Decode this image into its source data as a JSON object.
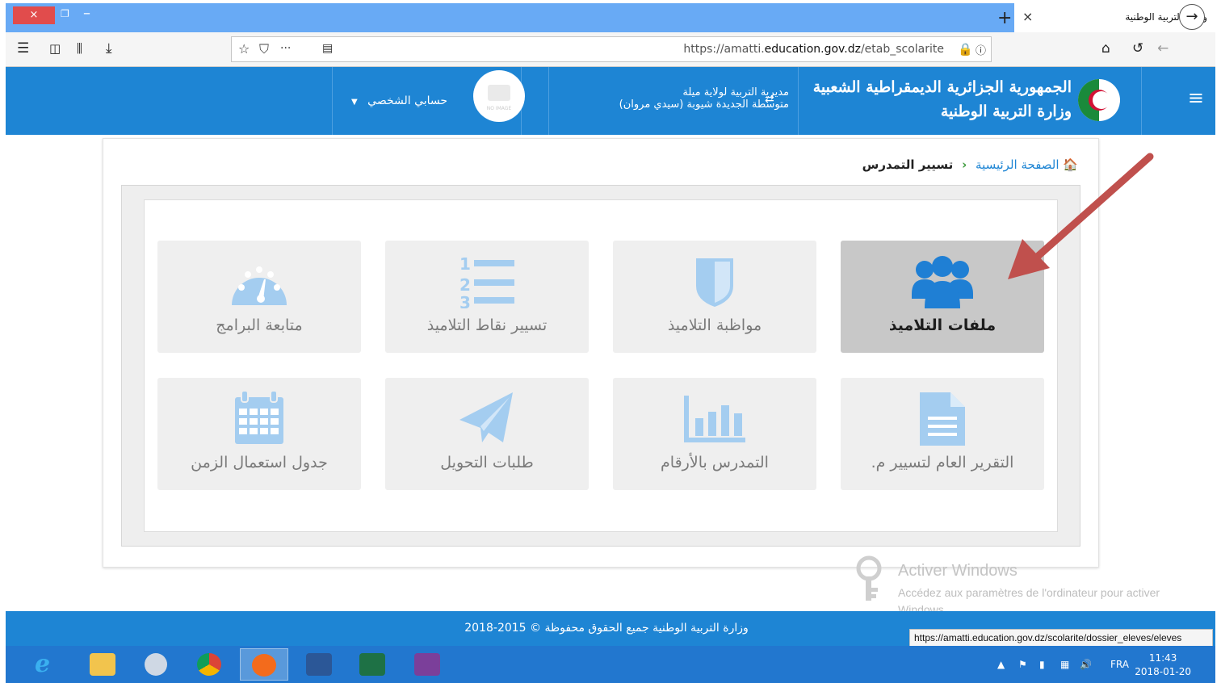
{
  "browser": {
    "tab_title": "وزارة التربية الوطنية",
    "tab_close": "×",
    "new_tab": "+",
    "window_close": "×",
    "url_prefix": "https://amatti.",
    "url_domain": "education.gov.dz",
    "url_path": "/etab_scolarite",
    "dots": "···"
  },
  "header": {
    "republic": "الجمهورية الجزائرية الديمقراطية الشعبية",
    "ministry": "وزارة التربية الوطنية",
    "directorate": "مديرية التربية لولاية ميلة",
    "school": "متوسطة الجديدة شيوبة (سيدي مروان)",
    "avatar_text": "NO IMAGE",
    "account": "حسابي الشخصي"
  },
  "breadcrumb": {
    "home": "الصفحة الرئيسية",
    "current": "تسيير التمدرس"
  },
  "tiles": [
    {
      "label": "ملفات التلاميذ",
      "icon": "users-icon",
      "active": true
    },
    {
      "label": "مواظبة التلاميذ",
      "icon": "shield-icon",
      "active": false
    },
    {
      "label": "تسيير نقاط التلاميذ",
      "icon": "ordered-list-icon",
      "active": false
    },
    {
      "label": "متابعة البرامج",
      "icon": "dashboard-icon",
      "active": false
    },
    {
      "label": "التقرير العام لتسيير م.",
      "icon": "document-icon",
      "active": false
    },
    {
      "label": "التمدرس بالأرقام",
      "icon": "bar-chart-icon",
      "active": false
    },
    {
      "label": "طلبات التحويل",
      "icon": "paper-plane-icon",
      "active": false
    },
    {
      "label": "جدول استعمال الزمن",
      "icon": "calendar-icon",
      "active": false
    }
  ],
  "watermark": {
    "title": "Activer Windows",
    "subtitle": "Accédez aux paramètres de l'ordinateur pour activer Windows."
  },
  "footer": {
    "text": "وزارة التربية الوطنية جميع الحقوق محفوظة © 2015-2018"
  },
  "status_url": "https://amatti.education.gov.dz/scolarite/dossier_eleves/eleves",
  "taskbar": {
    "lang": "FRA",
    "time": "11:43",
    "date": "2018-01-20"
  },
  "colors": {
    "brand_blue": "#1e85d4",
    "icon_blue": "#a4cdf0",
    "icon_blue_active": "#1f7fd4",
    "arrow_red": "#c0504d"
  }
}
